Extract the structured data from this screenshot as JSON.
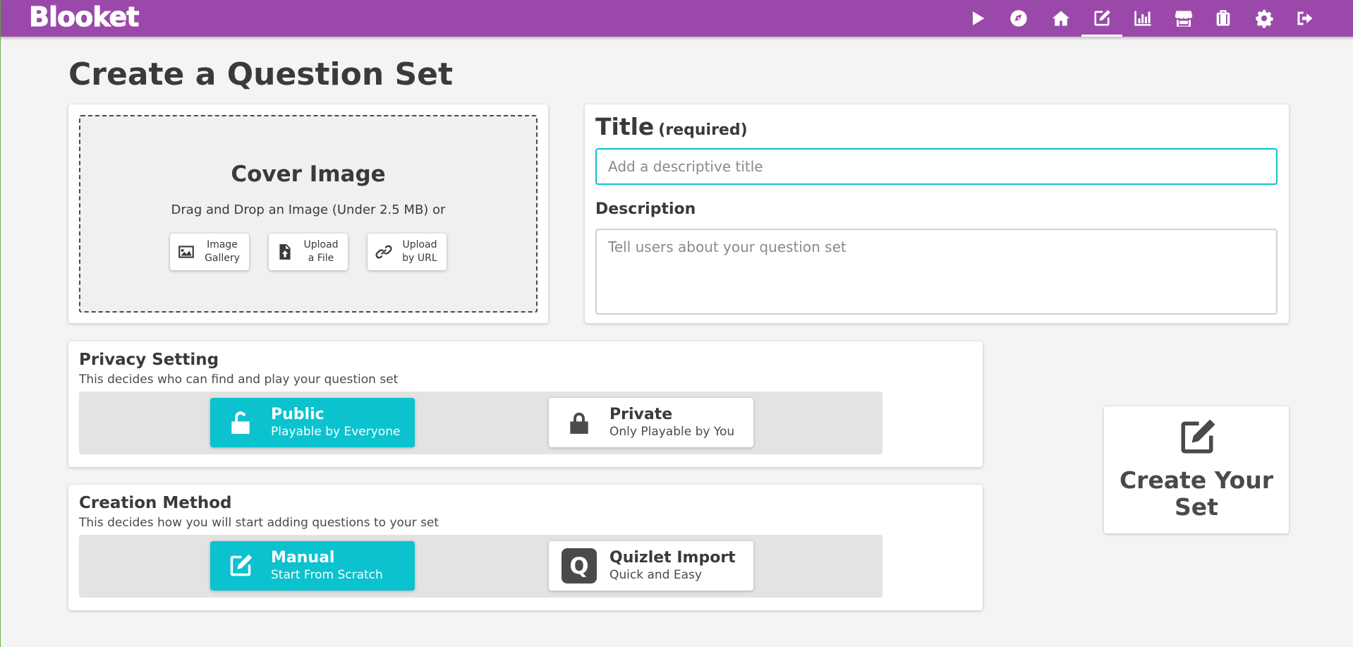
{
  "app": {
    "logo": "Blooket",
    "brand_color": "#9a49aa",
    "accent_color": "#0bc2cf"
  },
  "nav": {
    "items": [
      {
        "name": "play-icon",
        "active": false
      },
      {
        "name": "discover-compass-icon",
        "active": false
      },
      {
        "name": "home-icon",
        "active": false
      },
      {
        "name": "create-edit-icon",
        "active": true
      },
      {
        "name": "stats-chart-icon",
        "active": false
      },
      {
        "name": "market-store-icon",
        "active": false
      },
      {
        "name": "inventory-briefcase-icon",
        "active": false
      },
      {
        "name": "settings-gear-icon",
        "active": false
      },
      {
        "name": "logout-icon",
        "active": false
      }
    ]
  },
  "page": {
    "title": "Create a Question Set"
  },
  "cover": {
    "title": "Cover Image",
    "subtitle": "Drag and Drop an Image (Under 2.5 MB) or",
    "buttons": [
      {
        "line1": "Image",
        "line2": "Gallery",
        "icon": "image-icon"
      },
      {
        "line1": "Upload",
        "line2": "a File",
        "icon": "file-upload-icon"
      },
      {
        "line1": "Upload",
        "line2": "by URL",
        "icon": "link-icon"
      }
    ]
  },
  "details": {
    "title_label": "Title",
    "title_required": "(required)",
    "title_placeholder": "Add a descriptive title",
    "title_value": "",
    "description_label": "Description",
    "description_placeholder": "Tell users about your question set",
    "description_value": ""
  },
  "privacy": {
    "title": "Privacy Setting",
    "subtitle": "This decides who can find and play your question set",
    "options": [
      {
        "label": "Public",
        "sub": "Playable by Everyone",
        "icon": "unlock-icon",
        "selected": true
      },
      {
        "label": "Private",
        "sub": "Only Playable by You",
        "icon": "lock-icon",
        "selected": false
      }
    ]
  },
  "method": {
    "title": "Creation Method",
    "subtitle": "This decides how you will start adding questions to your set",
    "options": [
      {
        "label": "Manual",
        "sub": "Start From Scratch",
        "icon": "edit-icon",
        "selected": true
      },
      {
        "label": "Quizlet Import",
        "sub": "Quick and Easy",
        "icon": "quizlet-q-icon",
        "badge": "Q",
        "selected": false
      }
    ]
  },
  "create": {
    "line1": "Create Your",
    "line2": "Set",
    "icon": "edit-icon"
  }
}
